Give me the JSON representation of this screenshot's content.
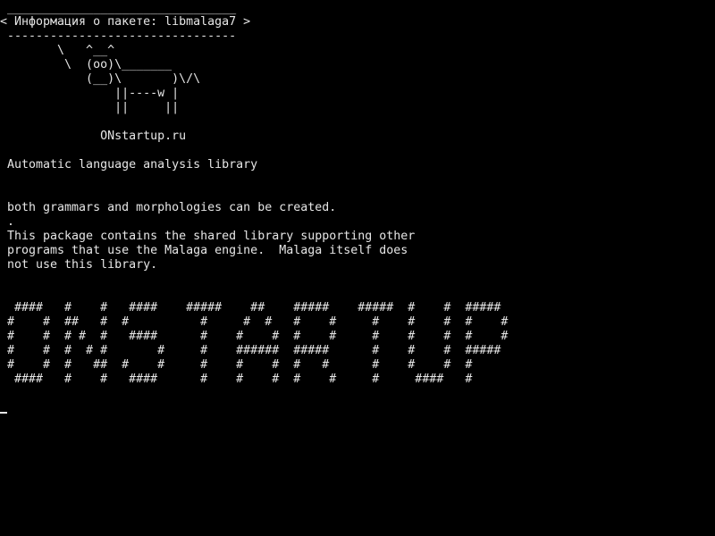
{
  "terminal": {
    "bubble_top": "________________________________",
    "bubble_title": "< Информация о пакете: libmalaga7 >",
    "bubble_bottom": "--------------------------------",
    "cow": [
      "       \\   ^__^",
      "        \\  (oo)\\_______",
      "           (__)\\       )\\/\\",
      "               ||----w |",
      "               ||     ||"
    ],
    "site": "             ONstartup.ru",
    "summary": "Automatic language analysis library",
    "description": [
      "both grammars and morphologies can be created.",
      ".",
      "This package contains the shared library supporting other",
      "programs that use the Malaga engine.  Malaga itself does",
      "not use this library."
    ],
    "banner": [
      " ####   #    #   ####    #####    ##    #####    #####  #    #  #####",
      "#    #  ##   #  #          #     #  #   #    #     #    #    #  #    #",
      "#    #  # #  #   ####      #    #    #  #    #     #    #    #  #    #",
      "#    #  #  # #       #     #    ######  #####      #    #    #  #####",
      "#    #  #   ##  #    #     #    #    #  #   #      #    #    #  #",
      " ####   #    #   ####      #    #    #  #    #     #     ####   #"
    ]
  }
}
